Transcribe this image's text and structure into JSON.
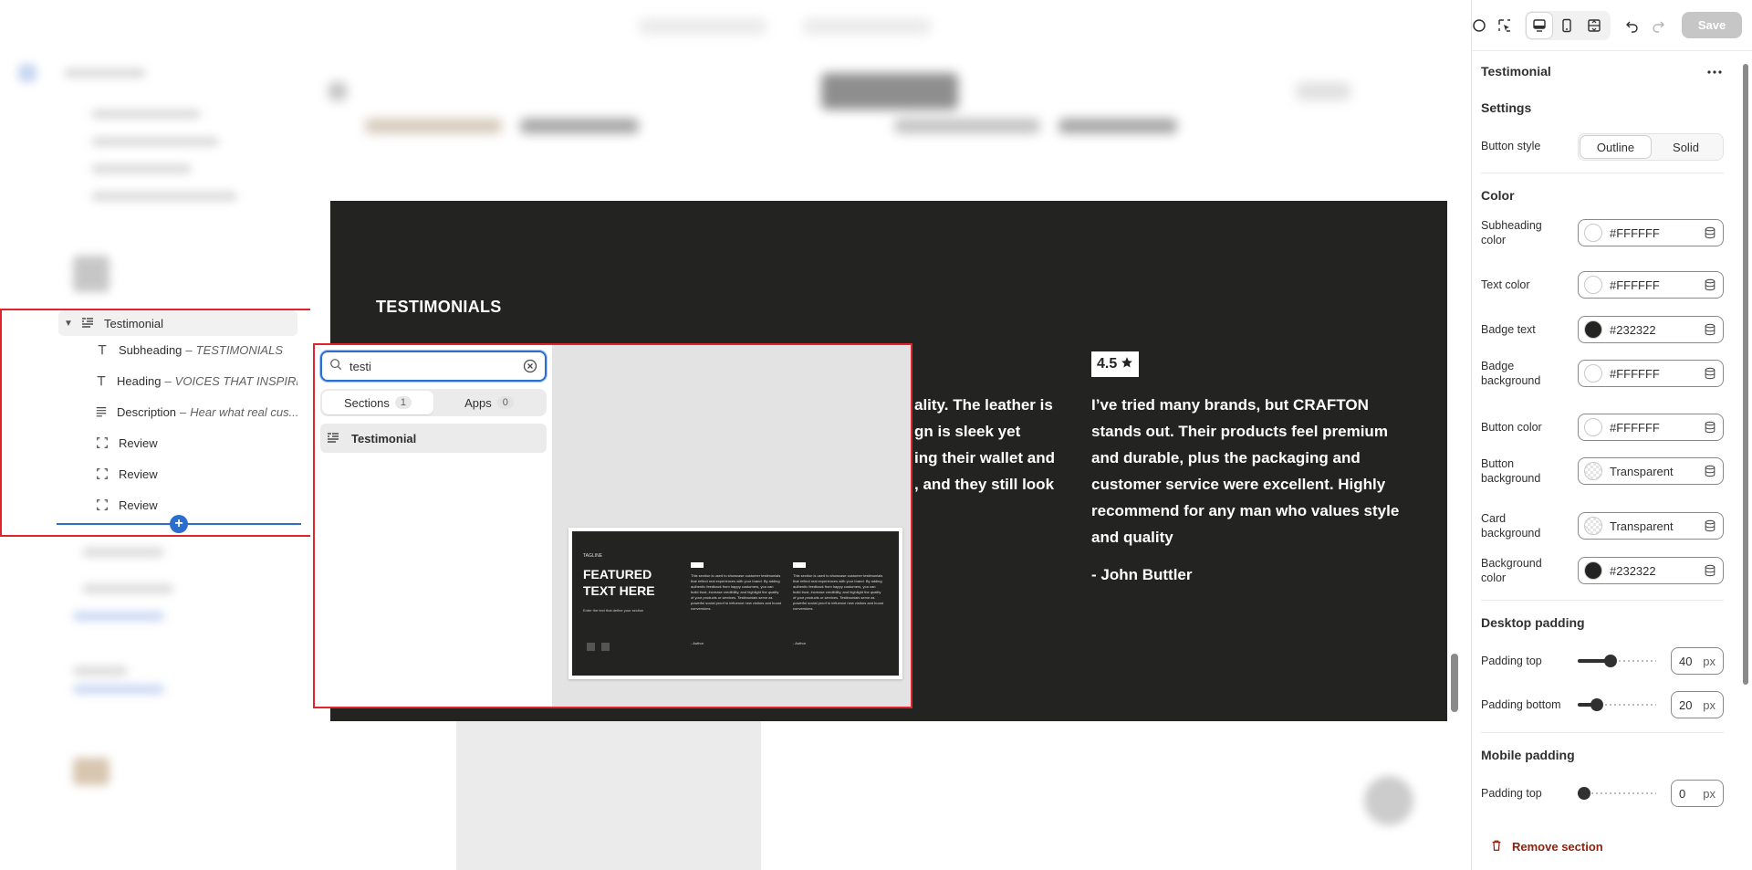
{
  "sidebar": {
    "section": {
      "label": "Testimonial"
    },
    "blocks": [
      {
        "type": "Subheading",
        "value": "TESTIMONIALS"
      },
      {
        "type": "Heading",
        "value": "VOICES THAT INSPIRE"
      },
      {
        "type": "Description",
        "value": "Hear what real cus..."
      },
      {
        "type": "Review",
        "value": ""
      },
      {
        "type": "Review",
        "value": ""
      },
      {
        "type": "Review",
        "value": ""
      }
    ],
    "dash": "–",
    "add_plus": "+"
  },
  "preview": {
    "section_title": "TESTIMONIALS",
    "review_partial_lines": [
      "ality. The leather is",
      "gn is sleek yet",
      "ing their wallet and",
      ", and they still look"
    ],
    "review_full_lines": [
      "I’ve tried many brands, but CRAFTON",
      "stands out. Their products feel premium",
      "and durable, plus the packaging and",
      "customer service were excellent. Highly",
      "recommend for any man who values style",
      "and quality"
    ],
    "badge_value": "4.5",
    "author": "- John Buttler"
  },
  "picker": {
    "search_value": "testi",
    "tabs": [
      {
        "label": "Sections",
        "count": "1",
        "active": true
      },
      {
        "label": "Apps",
        "count": "0",
        "active": false
      }
    ],
    "result": "Testimonial",
    "thumbnail": {
      "tagline": "TAGLINE",
      "title": "FEATURED TEXT HERE",
      "subtitle": "Enter the text that define your section",
      "column_text": "This section is used to showcase customer testimonials that reflect real experiences with your brand. By adding authentic feedback from happy customers, you can build trust, increase credibility, and highlight the quality of your products or services. Testimonials serve as powerful social proof to influence new visitors and boost conversions.",
      "author": "- Author"
    }
  },
  "right_panel": {
    "save_label": "Save",
    "title": "Testimonial",
    "settings_heading": "Settings",
    "button_style": {
      "label": "Button style",
      "options": [
        "Outline",
        "Solid"
      ],
      "selected": "Outline"
    },
    "color_heading": "Color",
    "colors": [
      {
        "label": "Subheading color",
        "value": "#FFFFFF",
        "swatch": "#FFFFFF"
      },
      {
        "label": "Text color",
        "value": "#FFFFFF",
        "swatch": "#FFFFFF"
      },
      {
        "label": "Badge text",
        "value": "#232322",
        "swatch": "#232322"
      },
      {
        "label": "Badge background",
        "value": "#FFFFFF",
        "swatch": "#FFFFFF"
      },
      {
        "label": "Button color",
        "value": "#FFFFFF",
        "swatch": "#FFFFFF"
      },
      {
        "label": "Button background",
        "value": "Transparent",
        "swatch": "transparent"
      },
      {
        "label": "Card background",
        "value": "Transparent",
        "swatch": "transparent"
      },
      {
        "label": "Background color",
        "value": "#232322",
        "swatch": "#232322"
      }
    ],
    "desktop_padding_heading": "Desktop padding",
    "desktop_padding": [
      {
        "label": "Padding top",
        "value": "40",
        "unit": "px",
        "fraction": 0.4
      },
      {
        "label": "Padding bottom",
        "value": "20",
        "unit": "px",
        "fraction": 0.2
      }
    ],
    "mobile_padding_heading": "Mobile padding",
    "mobile_padding": [
      {
        "label": "Padding top",
        "value": "0",
        "unit": "px",
        "fraction": 0.0
      }
    ],
    "remove_label": "Remove section"
  }
}
